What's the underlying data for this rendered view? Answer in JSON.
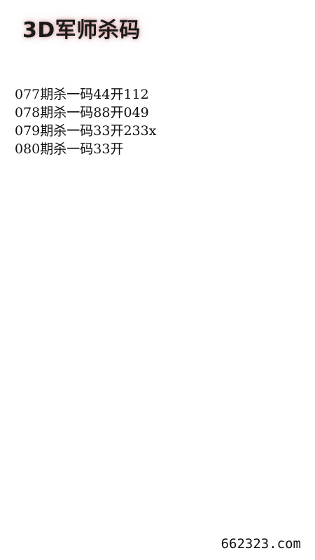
{
  "header": {
    "title": "3D军师杀码"
  },
  "records": [
    {
      "text": "077期杀一码44开112"
    },
    {
      "text": "078期杀一码88开049"
    },
    {
      "text": "079期杀一码33开233x"
    },
    {
      "text": "080期杀一码33开"
    }
  ],
  "footer": {
    "site": "662323.com"
  },
  "colors": {
    "background": "#ffffff",
    "text": "#111111",
    "title_glow": "#c07878"
  }
}
